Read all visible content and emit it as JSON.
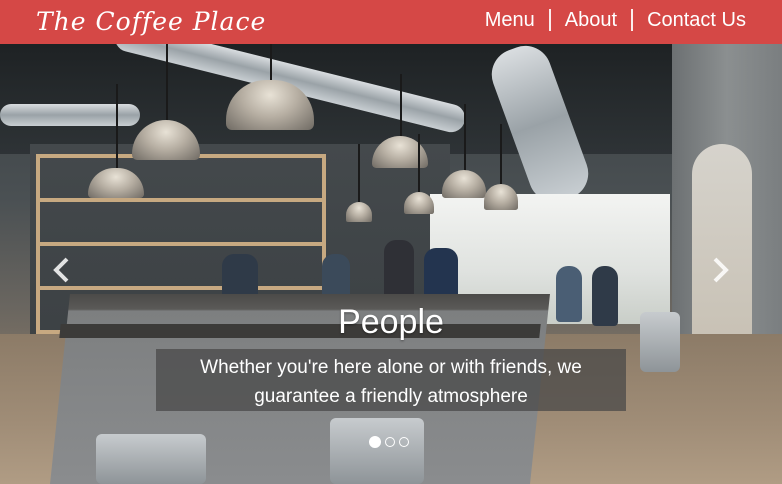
{
  "header": {
    "brand": "The Coffee Place",
    "nav": [
      {
        "label": "Menu"
      },
      {
        "label": "About"
      },
      {
        "label": "Contact Us"
      }
    ],
    "color": "#d54846"
  },
  "carousel": {
    "slide": {
      "title": "People",
      "text_line1": "Whether you're here alone or with friends, we",
      "text_line2": "guarantee a friendly atmosphere"
    },
    "indicators": {
      "count": 3,
      "active_index": 0
    },
    "prev_icon": "chevron-left-icon",
    "next_icon": "chevron-right-icon"
  }
}
